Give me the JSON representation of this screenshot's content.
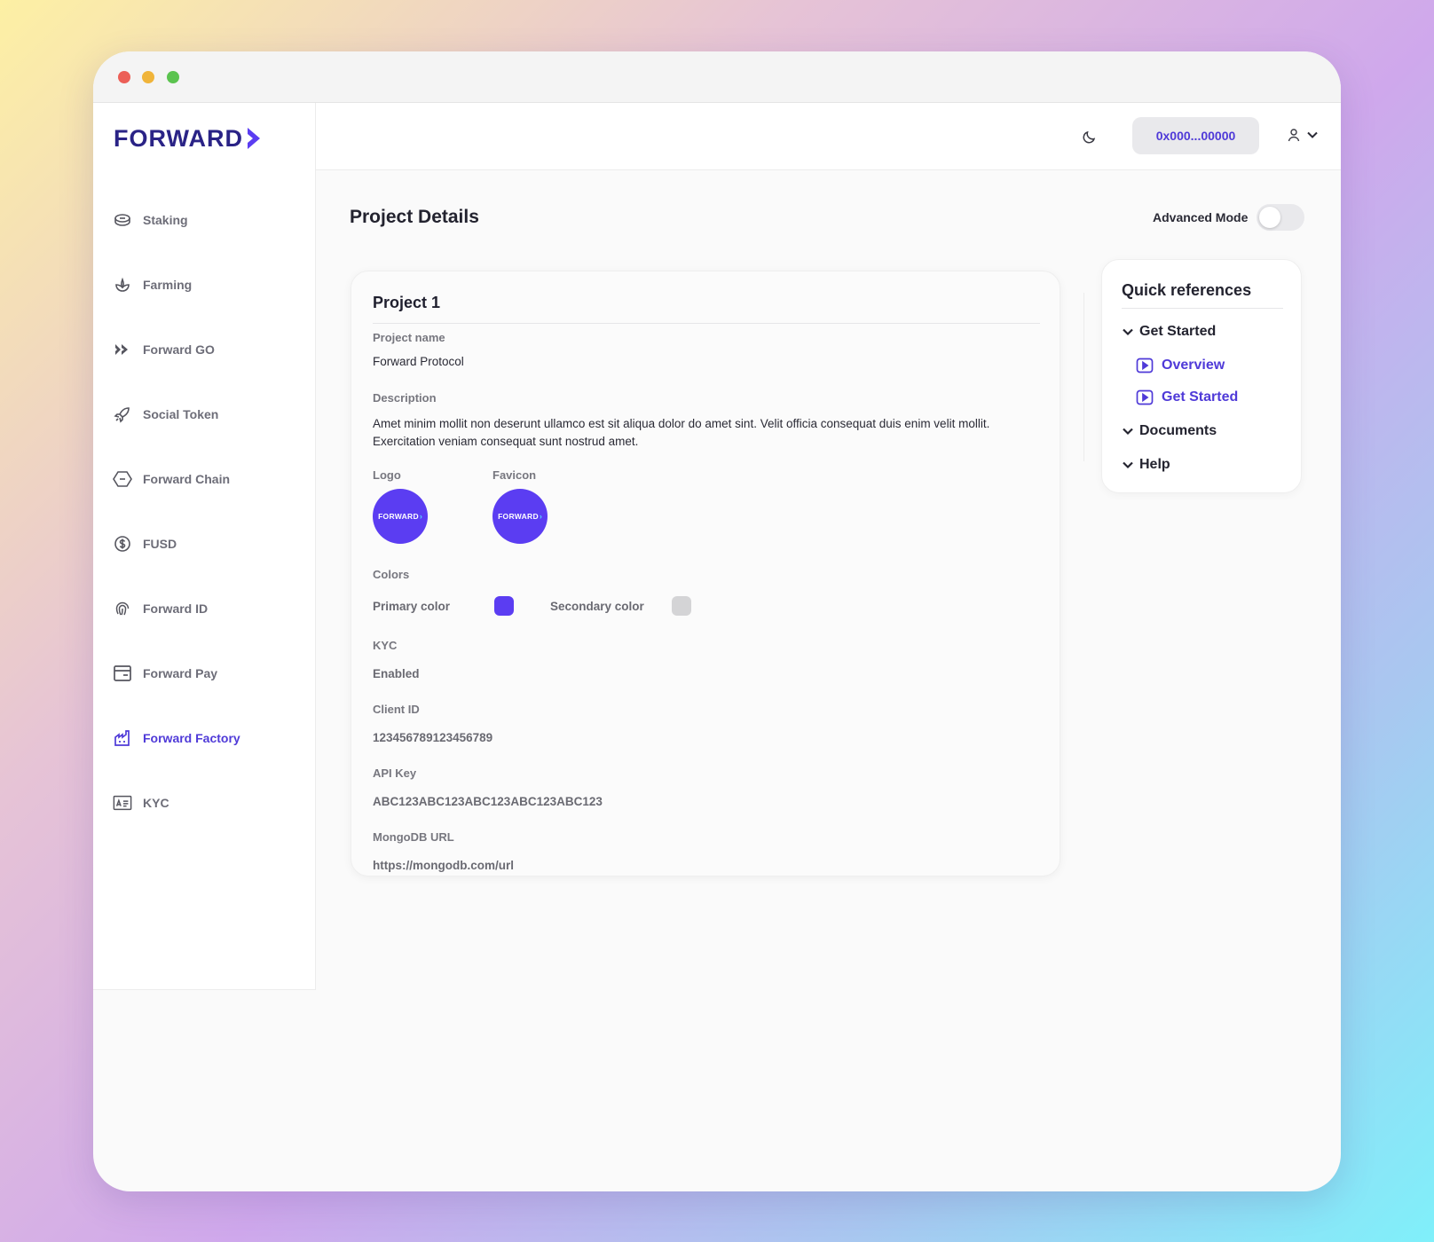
{
  "brand": {
    "name": "FORWARD",
    "accent": "#5b3df2",
    "dark": "#2a2386"
  },
  "sidebar": {
    "items": [
      {
        "label": "Staking",
        "icon": "coin-stack-icon"
      },
      {
        "label": "Farming",
        "icon": "sprout-icon"
      },
      {
        "label": "Forward GO",
        "icon": "double-chevron-icon"
      },
      {
        "label": "Social Token",
        "icon": "rocket-icon"
      },
      {
        "label": "Forward Chain",
        "icon": "chain-link-icon"
      },
      {
        "label": "FUSD",
        "icon": "dollar-coin-icon"
      },
      {
        "label": "Forward ID",
        "icon": "fingerprint-icon"
      },
      {
        "label": "Forward Pay",
        "icon": "wallet-card-icon"
      },
      {
        "label": "Forward Factory",
        "icon": "factory-icon",
        "active": true
      },
      {
        "label": "KYC",
        "icon": "id-card-icon"
      }
    ]
  },
  "topbar": {
    "wallet_address": "0x000...00000"
  },
  "page": {
    "title": "Project Details",
    "advanced_mode_label": "Advanced Mode",
    "advanced_mode_on": false
  },
  "project": {
    "title": "Project 1",
    "name_label": "Project name",
    "name_value": "Forward Protocol",
    "description_label": "Description",
    "description_value": "Amet minim mollit non deserunt ullamco est sit aliqua dolor do amet sint. Velit officia consequat duis enim velit mollit. Exercitation veniam consequat sunt nostrud amet.",
    "logo_label": "Logo",
    "favicon_label": "Favicon",
    "logo_text": "FORWARD",
    "colors_label": "Colors",
    "primary_color_label": "Primary color",
    "primary_color": "#5b3df2",
    "secondary_color_label": "Secondary color",
    "secondary_color": "#d4d4d6",
    "kyc_label": "KYC",
    "kyc_value": "Enabled",
    "client_id_label": "Client ID",
    "client_id_value": "123456789123456789",
    "api_key_label": "API Key",
    "api_key_value": "ABC123ABC123ABC123ABC123ABC123",
    "mongodb_label": "MongoDB URL",
    "mongodb_value": "https://mongodb.com/url"
  },
  "quick_references": {
    "title": "Quick references",
    "sections": [
      {
        "label": "Get Started",
        "links": [
          {
            "label": "Overview"
          },
          {
            "label": "Get Started"
          }
        ]
      },
      {
        "label": "Documents"
      },
      {
        "label": "Help"
      }
    ]
  }
}
